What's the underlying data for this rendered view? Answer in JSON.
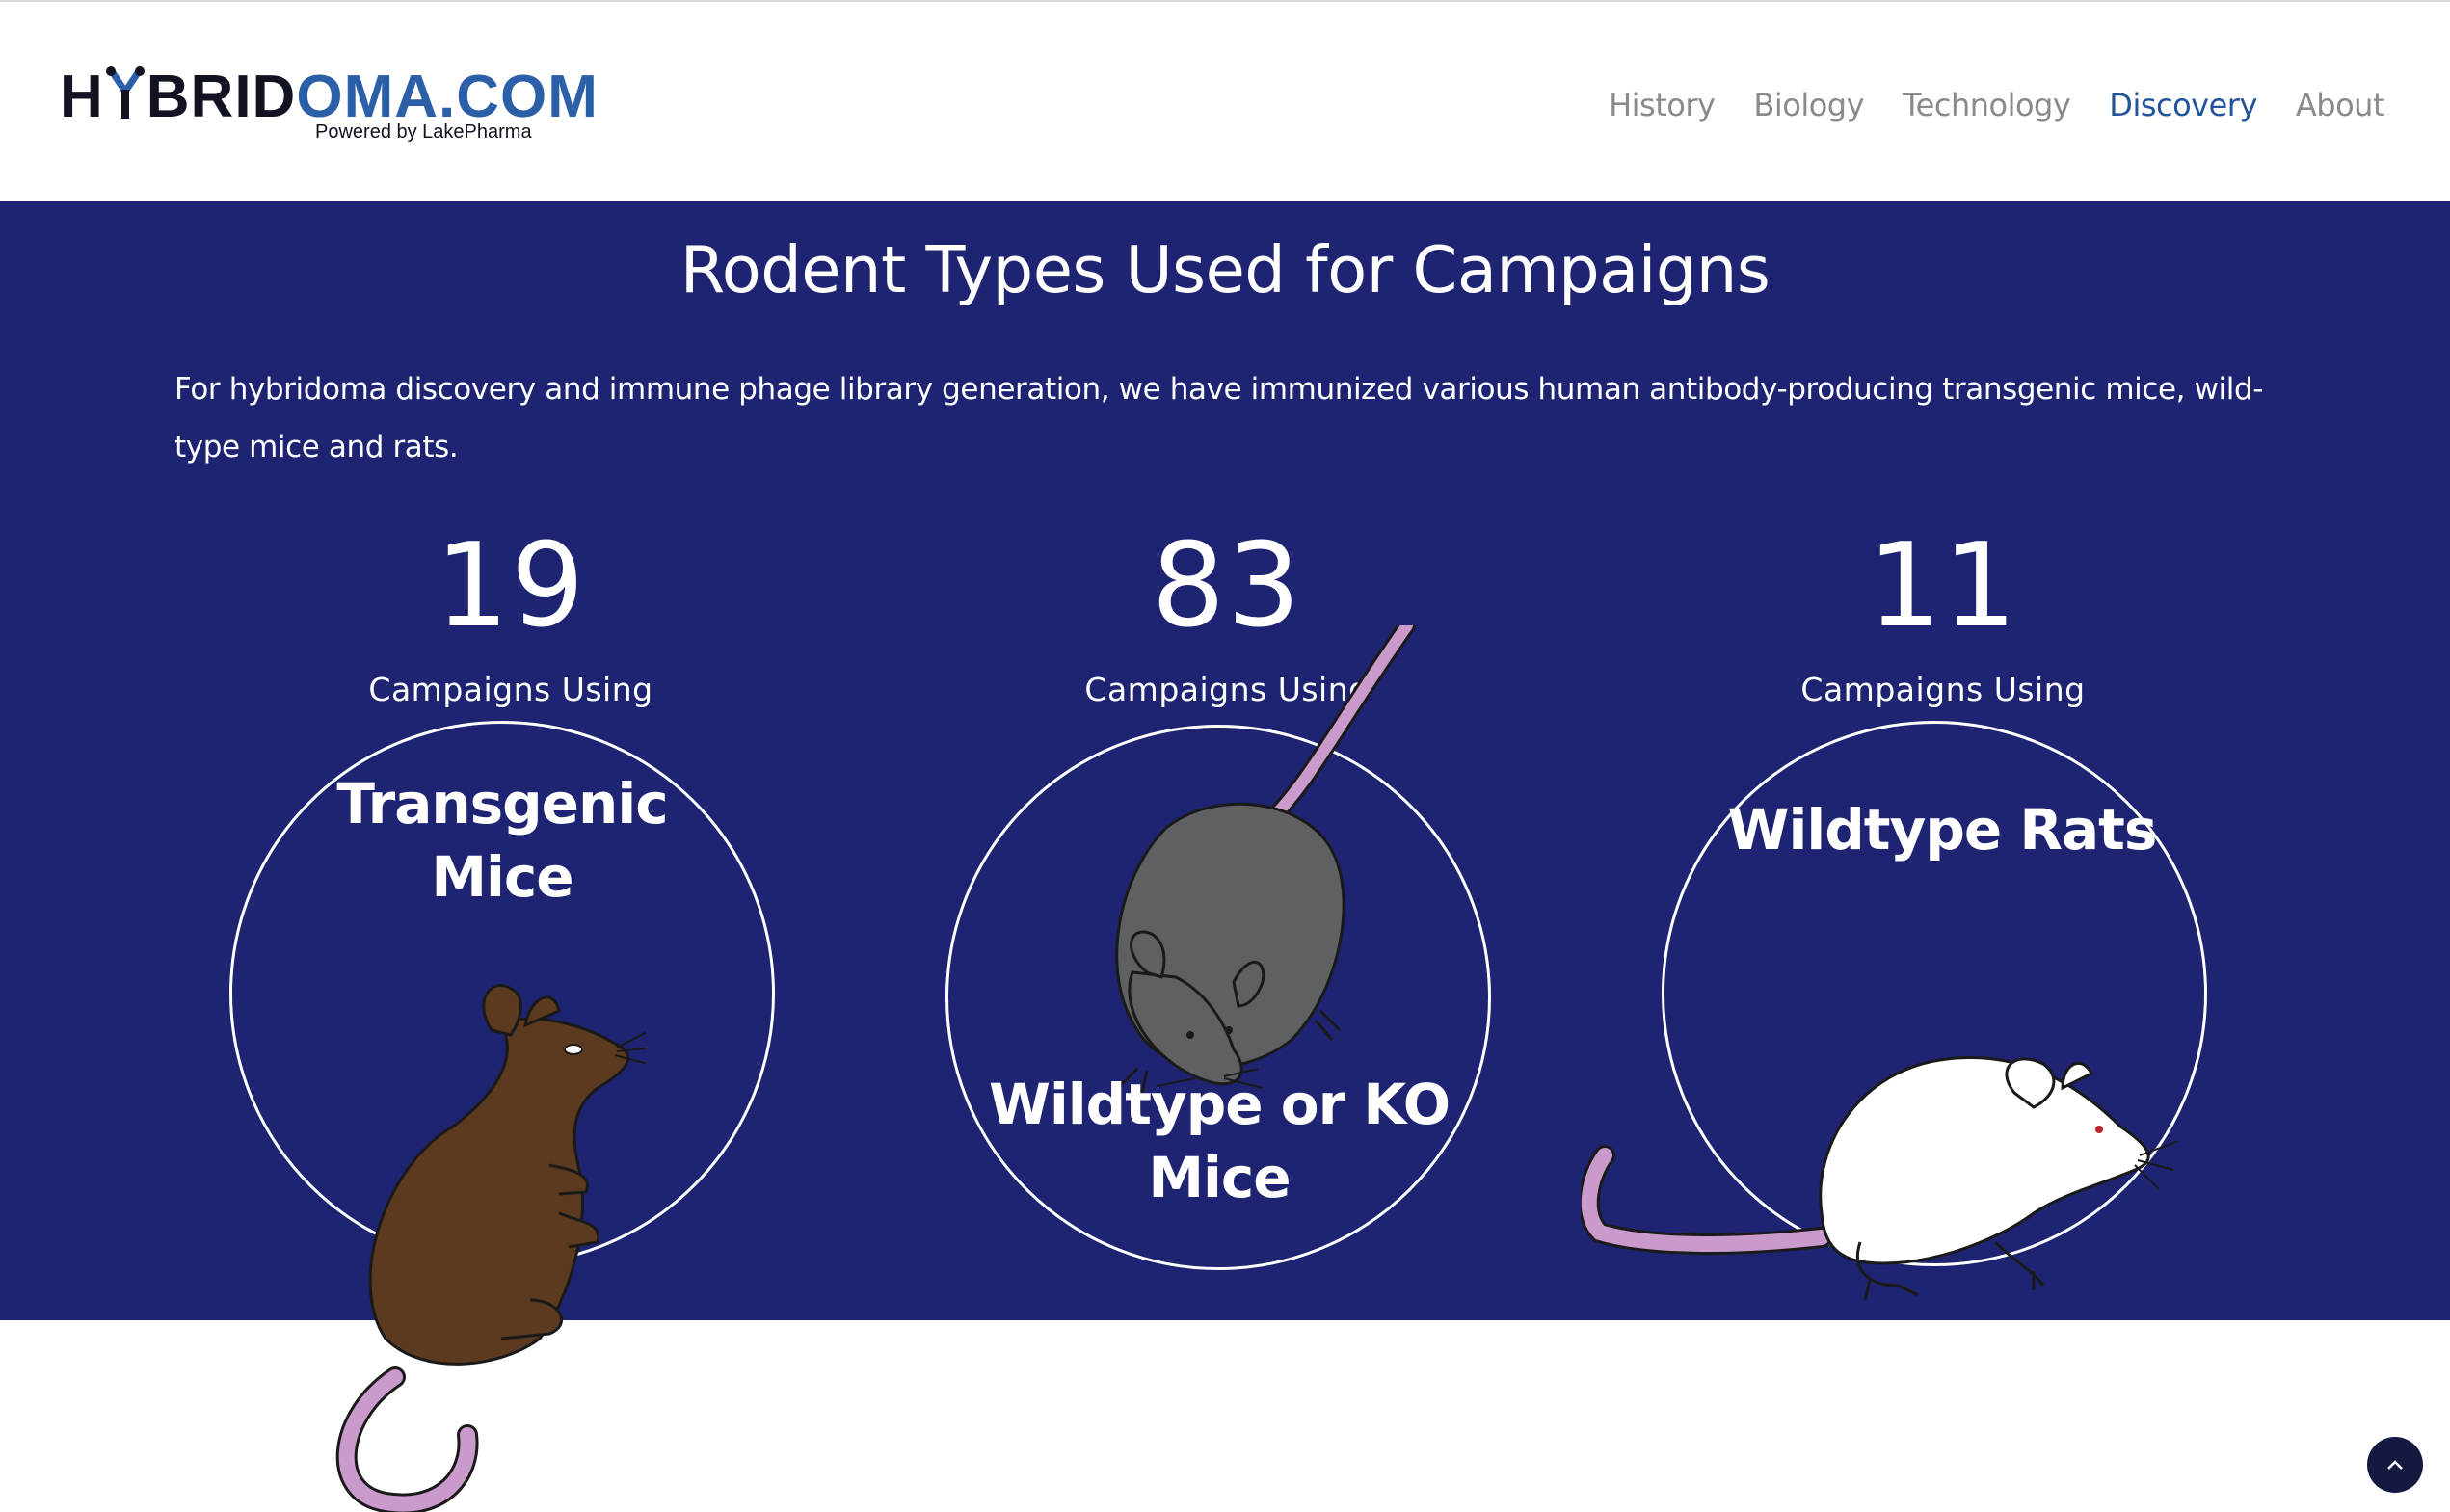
{
  "header": {
    "logo": {
      "part1": "H",
      "part2": "BRID",
      "part3": "OMA.COM",
      "tagline": "Powered by LakePharma"
    },
    "nav": [
      {
        "label": "History",
        "active": false
      },
      {
        "label": "Biology",
        "active": false
      },
      {
        "label": "Technology",
        "active": false
      },
      {
        "label": "Discovery",
        "active": true
      },
      {
        "label": "About",
        "active": false
      }
    ]
  },
  "main": {
    "title": "Rodent Types Used for Campaigns",
    "intro": "For hybridoma discovery and immune phage library generation, we have immunized various human antibody-producing transgenic mice, wild-type mice and rats.",
    "stats": [
      {
        "number": "19",
        "caption": "Campaigns Using",
        "label_line1": "Transgenic",
        "label_line2": "Mice",
        "icon": "brown-mouse-icon"
      },
      {
        "number": "83",
        "caption": "Campaigns Using",
        "label_line1": "Wildtype or KO",
        "label_line2": "Mice",
        "icon": "gray-mouse-icon"
      },
      {
        "number": "11",
        "caption": "Campaigns Using",
        "label_line1": "Wildtype Rats",
        "label_line2": "",
        "icon": "white-rat-icon"
      }
    ]
  },
  "scroll_top": {
    "icon": "chevron-up-icon"
  },
  "colors": {
    "background_main": "#1e2472",
    "accent_nav": "#23539b",
    "logo_blue": "#2b60a8",
    "mouse_brown": "#5c3a1f",
    "mouse_gray": "#5f6062",
    "tail_pink": "#c99acb"
  }
}
